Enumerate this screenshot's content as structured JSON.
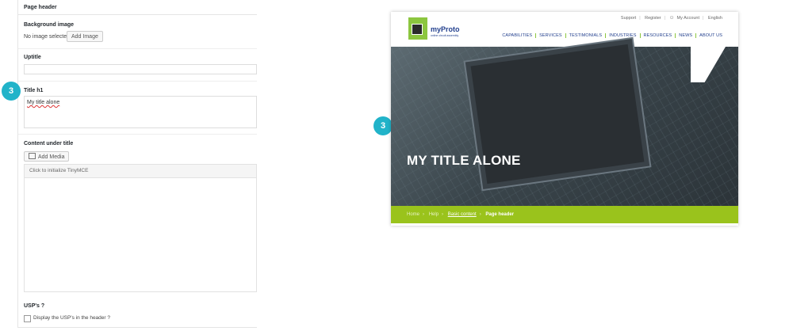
{
  "panel": {
    "title": "Page header",
    "background_image": {
      "label": "Background image",
      "status": "No image selected",
      "button": "Add Image"
    },
    "uptitle": {
      "label": "Uptitle",
      "value": ""
    },
    "title_h1": {
      "label": "Title h1",
      "value": "My title alone"
    },
    "content_under_title": {
      "label": "Content under title",
      "add_media": "Add Media",
      "editor_placeholder": "Click to initialize TinyMCE"
    },
    "usps": {
      "label": "USP's ?",
      "checkbox_label": "Display the USP's in the header ?"
    }
  },
  "badges": {
    "left": "3",
    "right": "3"
  },
  "site": {
    "topbar": [
      "Support",
      "Register",
      "My Account",
      "English"
    ],
    "logo": {
      "name": "myProto",
      "tagline": "online circuit assembly"
    },
    "nav": [
      "CAPABILITIES",
      "SERVICES",
      "TESTIMONIALS",
      "INDUSTRIES",
      "RESOURCES",
      "NEWS",
      "ABOUT US"
    ],
    "hero_title": "MY TITLE ALONE",
    "breadcrumbs": [
      "Home",
      "Help",
      "Basic content",
      "Page header"
    ]
  },
  "colors": {
    "accent_green": "#9ac31c",
    "badge_teal": "#21b3c9",
    "brand_blue": "#23408e"
  }
}
